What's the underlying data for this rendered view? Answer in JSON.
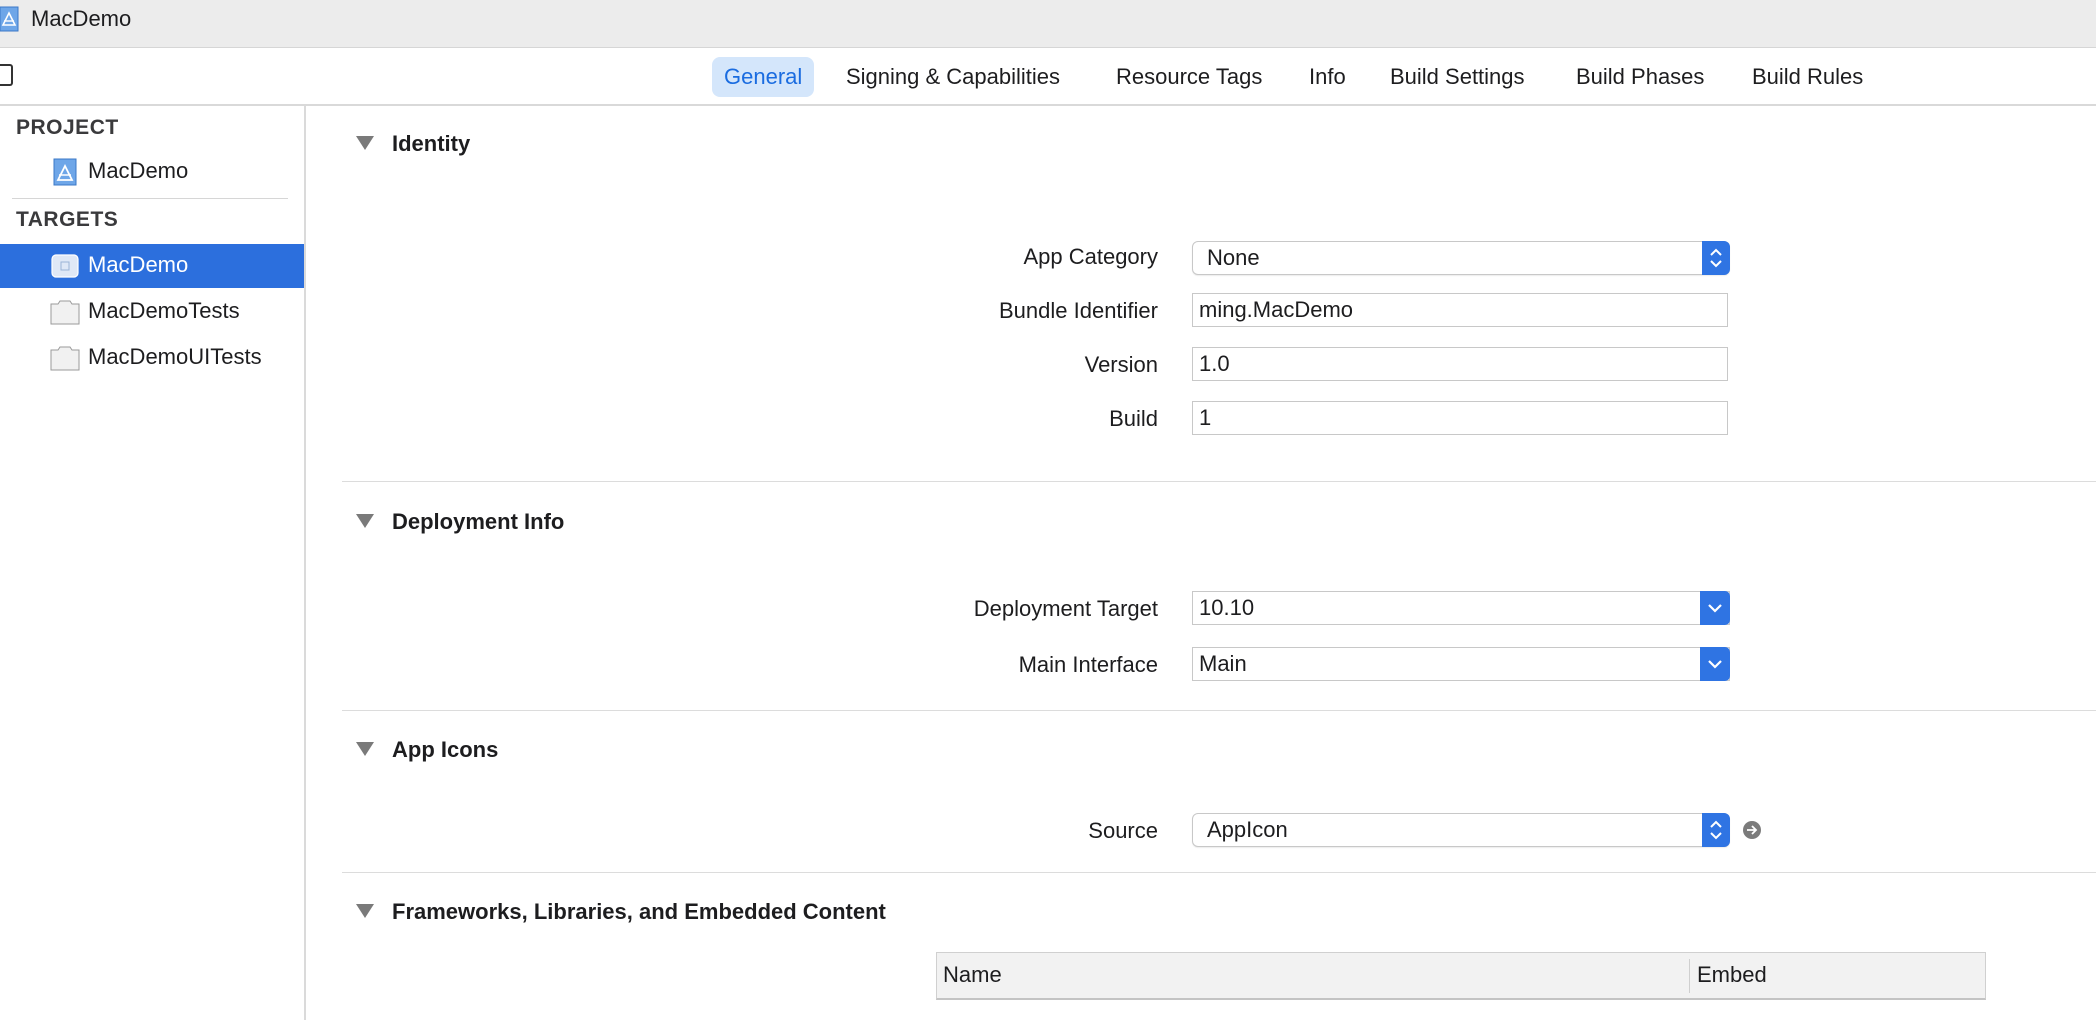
{
  "window": {
    "title": "MacDemo"
  },
  "tabs": [
    {
      "label": "General",
      "active": true
    },
    {
      "label": "Signing & Capabilities"
    },
    {
      "label": "Resource Tags"
    },
    {
      "label": "Info"
    },
    {
      "label": "Build Settings"
    },
    {
      "label": "Build Phases"
    },
    {
      "label": "Build Rules"
    }
  ],
  "sidebar": {
    "project_header": "PROJECT",
    "project_item": "MacDemo",
    "targets_header": "TARGETS",
    "targets": [
      {
        "label": "MacDemo",
        "selected": true
      },
      {
        "label": "MacDemoTests"
      },
      {
        "label": "MacDemoUITests"
      }
    ]
  },
  "identity": {
    "title": "Identity",
    "app_category_label": "App Category",
    "app_category_value": "None",
    "bundle_id_label": "Bundle Identifier",
    "bundle_id_value": "ming.MacDemo",
    "version_label": "Version",
    "version_value": "1.0",
    "build_label": "Build",
    "build_value": "1"
  },
  "deployment": {
    "title": "Deployment Info",
    "target_label": "Deployment Target",
    "target_value": "10.10",
    "main_interface_label": "Main Interface",
    "main_interface_value": "Main"
  },
  "app_icons": {
    "title": "App Icons",
    "source_label": "Source",
    "source_value": "AppIcon"
  },
  "frameworks": {
    "title": "Frameworks, Libraries, and Embedded Content",
    "columns": [
      "Name",
      "Embed"
    ]
  },
  "colors": {
    "selection": "#2c6fdd",
    "tab_active_bg": "#d4e6fb",
    "tab_active_text": "#1a6ce0"
  }
}
